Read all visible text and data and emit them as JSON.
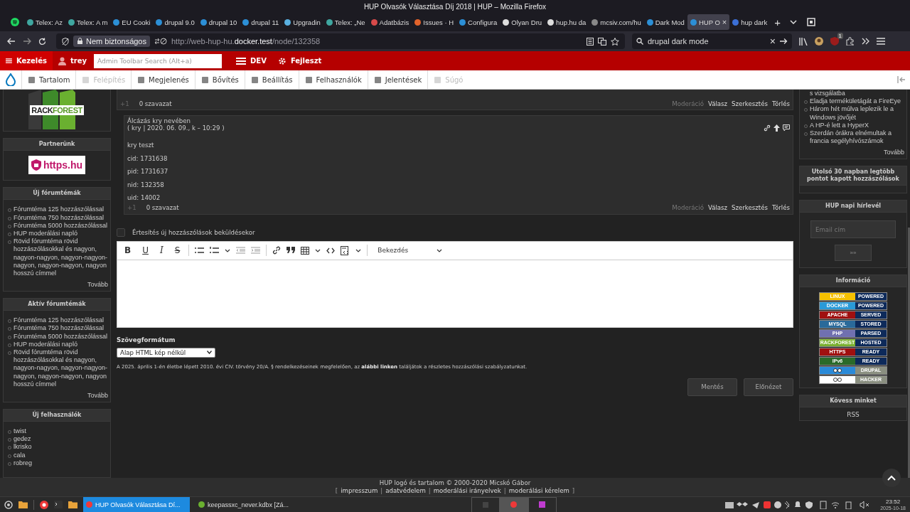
{
  "window": {
    "title": "HUP Olvasók Választása Díj 2018 | HUP – Mozilla Firefox"
  },
  "tabs": [
    {
      "title": "Telex: Az",
      "color": "#3fa7a0",
      "selected": false
    },
    {
      "title": "Telex: A m",
      "color": "#3fa7a0",
      "selected": false
    },
    {
      "title": "EU Cooki",
      "color": "#2c8fd6",
      "selected": false
    },
    {
      "title": "drupal 9.0",
      "color": "#2c8fd6",
      "selected": false
    },
    {
      "title": "drupal 10",
      "color": "#2c8fd6",
      "selected": false
    },
    {
      "title": "drupal 11",
      "color": "#2c8fd6",
      "selected": false
    },
    {
      "title": "Upgradin",
      "color": "#5ab0e0",
      "selected": false
    },
    {
      "title": "Telex: „Ne",
      "color": "#3fa7a0",
      "selected": false
    },
    {
      "title": "Adatbázis",
      "color": "#d84a4a",
      "selected": false
    },
    {
      "title": "Issues · H",
      "color": "#e2632b",
      "selected": false
    },
    {
      "title": "Configura",
      "color": "#2c8fd6",
      "selected": false
    },
    {
      "title": "Olyan Dru",
      "color": "#dddddd",
      "selected": false
    },
    {
      "title": "hup.hu da",
      "color": "#dddddd",
      "selected": false
    },
    {
      "title": "mcsiv.com/hu",
      "color": "#888888",
      "selected": false
    },
    {
      "title": "Dark Mod",
      "color": "#2c8fd6",
      "selected": false
    },
    {
      "title": "HUP O",
      "color": "#2c8fd6",
      "selected": true,
      "close": "×"
    },
    {
      "title": "hup dark",
      "color": "#3b6fd6",
      "selected": false
    }
  ],
  "new_tab": "+",
  "address_bar": {
    "security": "Nem biztonságos",
    "url": [
      {
        "text": "http://web-hup-hu.",
        "strong": false
      },
      {
        "text": "docker.test",
        "strong": true
      },
      {
        "text": "/node/132358",
        "strong": false
      }
    ]
  },
  "search_bar": {
    "value": "drupal dark mode",
    "clear": "×"
  },
  "extension_badge": "1",
  "admin_toolbar": {
    "manage": "Kezelés",
    "user": "trey",
    "search_placeholder": "Admin Toolbar Search (Alt+a)",
    "env": "DEV",
    "devel": "Fejleszt"
  },
  "admin_menu": [
    {
      "label": "Tartalom",
      "disabled": false
    },
    {
      "label": "Felépítés",
      "disabled": true
    },
    {
      "label": "Megjelenés",
      "disabled": false
    },
    {
      "label": "Bővítés",
      "disabled": false
    },
    {
      "label": "Beállítás",
      "disabled": false
    },
    {
      "label": "Felhasználók",
      "disabled": false
    },
    {
      "label": "Jelentések",
      "disabled": false
    },
    {
      "label": "Súgó",
      "disabled": true
    }
  ],
  "sponsor_logo": {
    "left": "RACK",
    "right": "FOREST"
  },
  "left_blocks": [
    {
      "title": "Partnerünk",
      "kind": "partner",
      "logo": "https.hu"
    },
    {
      "title": "Új fórumtémák",
      "kind": "list",
      "items": [
        "Fórumtéma 125 hozzászólással",
        "Fórumtéma 750 hozzászólással",
        "Fórumtéma 5000 hozzászólással",
        "HUP moderálási napló",
        "Rövid fórumtéma rövid hozzászólásokkal és nagyon, nagyon-nagyon, nagyon-nagyon-nagyon, nagyon-nagyon, nagyon hosszú címmel"
      ],
      "more": "Tovább"
    },
    {
      "title": "Aktív fórumtémák",
      "kind": "list",
      "items": [
        "Fórumtéma 125 hozzászólással",
        "Fórumtéma 750 hozzászólással",
        "Fórumtéma 5000 hozzászólással",
        "HUP moderálási napló",
        "Rövid fórumtéma rövid hozzászólásokkal és nagyon, nagyon-nagyon, nagyon-nagyon-nagyon, nagyon-nagyon, nagyon hosszú címmel"
      ],
      "more": "Tovább"
    },
    {
      "title": "Új felhasználók",
      "kind": "list",
      "items": [
        "twist",
        "gedez",
        "lkrisko",
        "cala",
        "robreg"
      ]
    }
  ],
  "comments": [
    {
      "partial": true,
      "votes_label": "+1",
      "votes": "0 szavazat",
      "actions": [
        {
          "label": "Moderáció",
          "disabled": true
        },
        {
          "label": "Válasz",
          "disabled": false
        },
        {
          "label": "Szerkesztés",
          "disabled": false
        },
        {
          "label": "Törlés",
          "disabled": false
        }
      ]
    },
    {
      "partial": false,
      "author": "Álcázás kry nevében",
      "meta": "( kry | 2020. 06. 09., k – 10:29 )",
      "body": [
        "kry teszt",
        "cid: 1731638",
        "pid: 1731637",
        "nid: 132358",
        "uid: 14002"
      ],
      "votes_label": "+1",
      "votes": "0 szavazat",
      "actions": [
        {
          "label": "Moderáció",
          "disabled": true
        },
        {
          "label": "Válasz",
          "disabled": false
        },
        {
          "label": "Szerkesztés",
          "disabled": false
        },
        {
          "label": "Törlés",
          "disabled": false
        }
      ]
    }
  ],
  "notify": {
    "label": "Értesítés új hozzászólások beküldésekor",
    "checked": false
  },
  "editor": {
    "format_buttons": [
      {
        "label": "B",
        "kind": "bold"
      },
      {
        "label": "U",
        "kind": "underline"
      },
      {
        "label": "I",
        "kind": "italic"
      },
      {
        "label": "S",
        "kind": "strike"
      }
    ],
    "block_format": "Bekezdés"
  },
  "text_format": {
    "label": "Szövegformátum",
    "value": "Alap HTML kép nélkül"
  },
  "notice": {
    "before": "A 2025. április 1-én életbe lépett 2010. évi CIV. törvény 20/A. § rendelkezéseinek megfelelően, az",
    "link": "alábbi linken",
    "after": "találjátok a részletes hozzászólási szabályzatunkat."
  },
  "form_buttons": [
    "Mentés",
    "Előnézet"
  ],
  "right_top_block": {
    "cut_text": "s vizsgálatba",
    "items": [
      "Eladja termékületágát a FireEye",
      "Három hét múlva leplezik le a Windows jövőjét",
      "A HP-é lett a HyperX",
      "Szerdán órákra elnémultak a francia segélyhívószámok"
    ],
    "more": "Tovább"
  },
  "right_blocks": [
    {
      "title": "Utolsó 30 napban legtöbb pontot kapott hozzászólások",
      "kind": "empty"
    },
    {
      "title": "HUP napi hírlevél",
      "kind": "newsletter",
      "placeholder": "Email cím",
      "button": "»»"
    },
    {
      "title": "Információ",
      "kind": "badges",
      "badges": [
        {
          "kind": "text",
          "left": "LINUX",
          "right": "POWERED",
          "color": "#f5c000"
        },
        {
          "kind": "text",
          "left": "DOCKER",
          "right": "POWERED",
          "color": "#2a9ad8"
        },
        {
          "kind": "text",
          "left": "APACHE",
          "right": "SERVED",
          "color": "#a01010"
        },
        {
          "kind": "text",
          "left": "MYSQL",
          "right": "STORED",
          "color": "#2a6a9a"
        },
        {
          "kind": "text",
          "left": "PHP",
          "right": "PARSED",
          "color": "#7070b0"
        },
        {
          "kind": "text",
          "left": "RACKFOREST",
          "right": "HOSTED",
          "color": "#7ab030"
        },
        {
          "kind": "text",
          "left": "HTTPS",
          "right": "READY",
          "color": "#a01010"
        },
        {
          "kind": "text",
          "left": "IPv6",
          "right": "READY",
          "color": "#2a6a2a"
        },
        {
          "kind": "icon",
          "right": "DRUPAL",
          "color": "#2a8ad8"
        },
        {
          "kind": "icon",
          "right": "HACKER",
          "color": "#ffffff"
        }
      ]
    },
    {
      "title": "Kövess minket",
      "kind": "links",
      "items": [
        "RSS"
      ]
    }
  ],
  "footer": {
    "credit": "HUP logó és tartalom © 2000-2020 Micskó Gábor",
    "links": [
      {
        "text": "[",
        "kind": "punct"
      },
      {
        "text": "impresszum",
        "kind": "link"
      },
      {
        "text": "|",
        "kind": "punct"
      },
      {
        "text": "adatvédelem",
        "kind": "link"
      },
      {
        "text": "|",
        "kind": "punct"
      },
      {
        "text": "moderálási irányelvek",
        "kind": "link"
      },
      {
        "text": "|",
        "kind": "punct"
      },
      {
        "text": "moderálási kérelem",
        "kind": "link"
      },
      {
        "text": "]",
        "kind": "punct"
      }
    ]
  },
  "taskbar": {
    "tasks": [
      {
        "label": "HUP Olvasók Választása Dí...",
        "selected": true
      },
      {
        "label": "keepassxc_never.kdbx [Zá...",
        "selected": false
      }
    ],
    "time": "23:52",
    "date": "2025-10-18"
  }
}
